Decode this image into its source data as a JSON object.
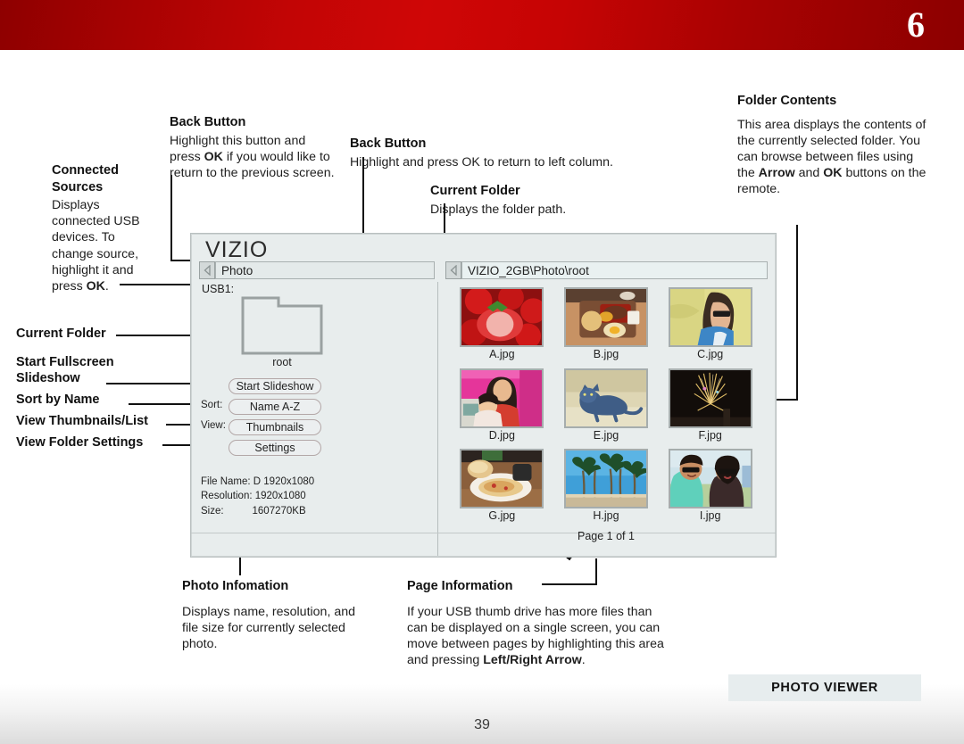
{
  "header": {
    "chapter_number": "6"
  },
  "footer": {
    "page_number": "39",
    "section_badge": "PHOTO VIEWER"
  },
  "annotations": {
    "connected_sources": {
      "title": "Connected Sources",
      "body_1": "Displays connected USB devices. To change source, highlight it and press ",
      "body_bold": "OK",
      "body_2": "."
    },
    "back_button_left": {
      "title": "Back Button",
      "body_1": "Highlight this button and press ",
      "body_bold": "OK",
      "body_2": " if you would like to return to the previous screen."
    },
    "back_button_center": {
      "title": "Back Button",
      "body": "Highlight and press OK to return to left column."
    },
    "current_folder_top": {
      "title": "Current Folder",
      "body": "Displays the folder path."
    },
    "folder_contents": {
      "title": "Folder Contents",
      "body_1": "This area displays the contents of the currently selected folder. You can browse between files using the ",
      "bold_1": "Arrow",
      "body_2": " and ",
      "bold_2": "OK",
      "body_3": " buttons on the remote."
    },
    "photo_information": {
      "title": "Photo Infomation",
      "body": "Displays name, resolution, and file size for currently selected photo."
    },
    "page_information": {
      "title": "Page Information",
      "body_1": "If your USB thumb drive has more files than can be displayed on a single screen, you can move between pages by highlighting this area and pressing ",
      "bold_1": "Left/Right Arrow",
      "body_2": "."
    },
    "labels": {
      "current_folder": "Current Folder",
      "start_fullscreen_slideshow": "Start Fullscreen Slideshow",
      "sort_by_name": "Sort by Name",
      "view_thumbnails_list": "View Thumbnails/List",
      "view_folder_settings": "View Folder Settings"
    }
  },
  "tv_screen": {
    "brand_logo": "VIZIO",
    "back_icon": "back-arrow-icon",
    "tab_label": "Photo",
    "folder_path": "VIZIO_2GB\\Photo\\root",
    "source_label": "USB1:",
    "folder_item": {
      "icon": "folder-icon",
      "name": "root"
    },
    "buttons": {
      "start_slideshow": "Start Slideshow",
      "sort_prefix": "Sort:",
      "sort_value": "Name A-Z",
      "view_prefix": "View:",
      "view_value": "Thumbnails",
      "settings": "Settings"
    },
    "file_info": {
      "file_name": "File Name: D 1920x1080",
      "resolution": "Resolution: 1920x1080",
      "size": "Size:          1607270KB"
    },
    "thumbnails": [
      {
        "caption": "A.jpg",
        "art": "strawberries"
      },
      {
        "caption": "B.jpg",
        "art": "meal-tray"
      },
      {
        "caption": "C.jpg",
        "art": "woman-sunglasses"
      },
      {
        "caption": "D.jpg",
        "art": "two-girls"
      },
      {
        "caption": "E.jpg",
        "art": "cat"
      },
      {
        "caption": "F.jpg",
        "art": "fireworks"
      },
      {
        "caption": "G.jpg",
        "art": "pasta-plate"
      },
      {
        "caption": "H.jpg",
        "art": "palm-trees"
      },
      {
        "caption": "I.jpg",
        "art": "couple-selfie"
      }
    ],
    "page_indicator": "Page 1 of 1"
  },
  "colors": {
    "header_red": "#c20505",
    "header_red_dark": "#8e0000",
    "screen_bg": "#e8eded",
    "badge_bg": "#e7edee"
  }
}
